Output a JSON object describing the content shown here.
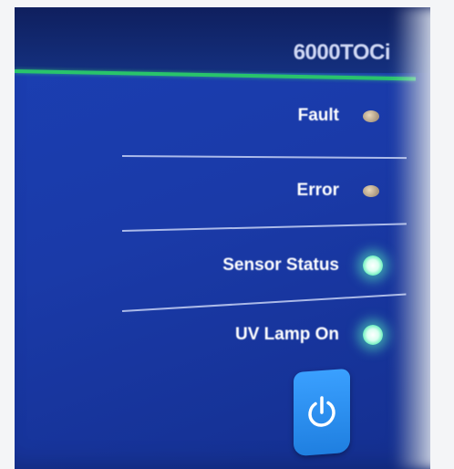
{
  "device": {
    "model": "6000TOCi"
  },
  "indicators": [
    {
      "label": "Fault",
      "state": "off"
    },
    {
      "label": "Error",
      "state": "off"
    },
    {
      "label": "Sensor Status",
      "state": "on"
    },
    {
      "label": "UV Lamp On",
      "state": "on"
    }
  ],
  "colors": {
    "panel": "#1a3aa8",
    "accent_line": "#29c46b",
    "power_button": "#2a8cf0",
    "led_on": "#6ff0bf",
    "led_off": "#a99780"
  },
  "icons": {
    "power_button": "power-icon"
  }
}
